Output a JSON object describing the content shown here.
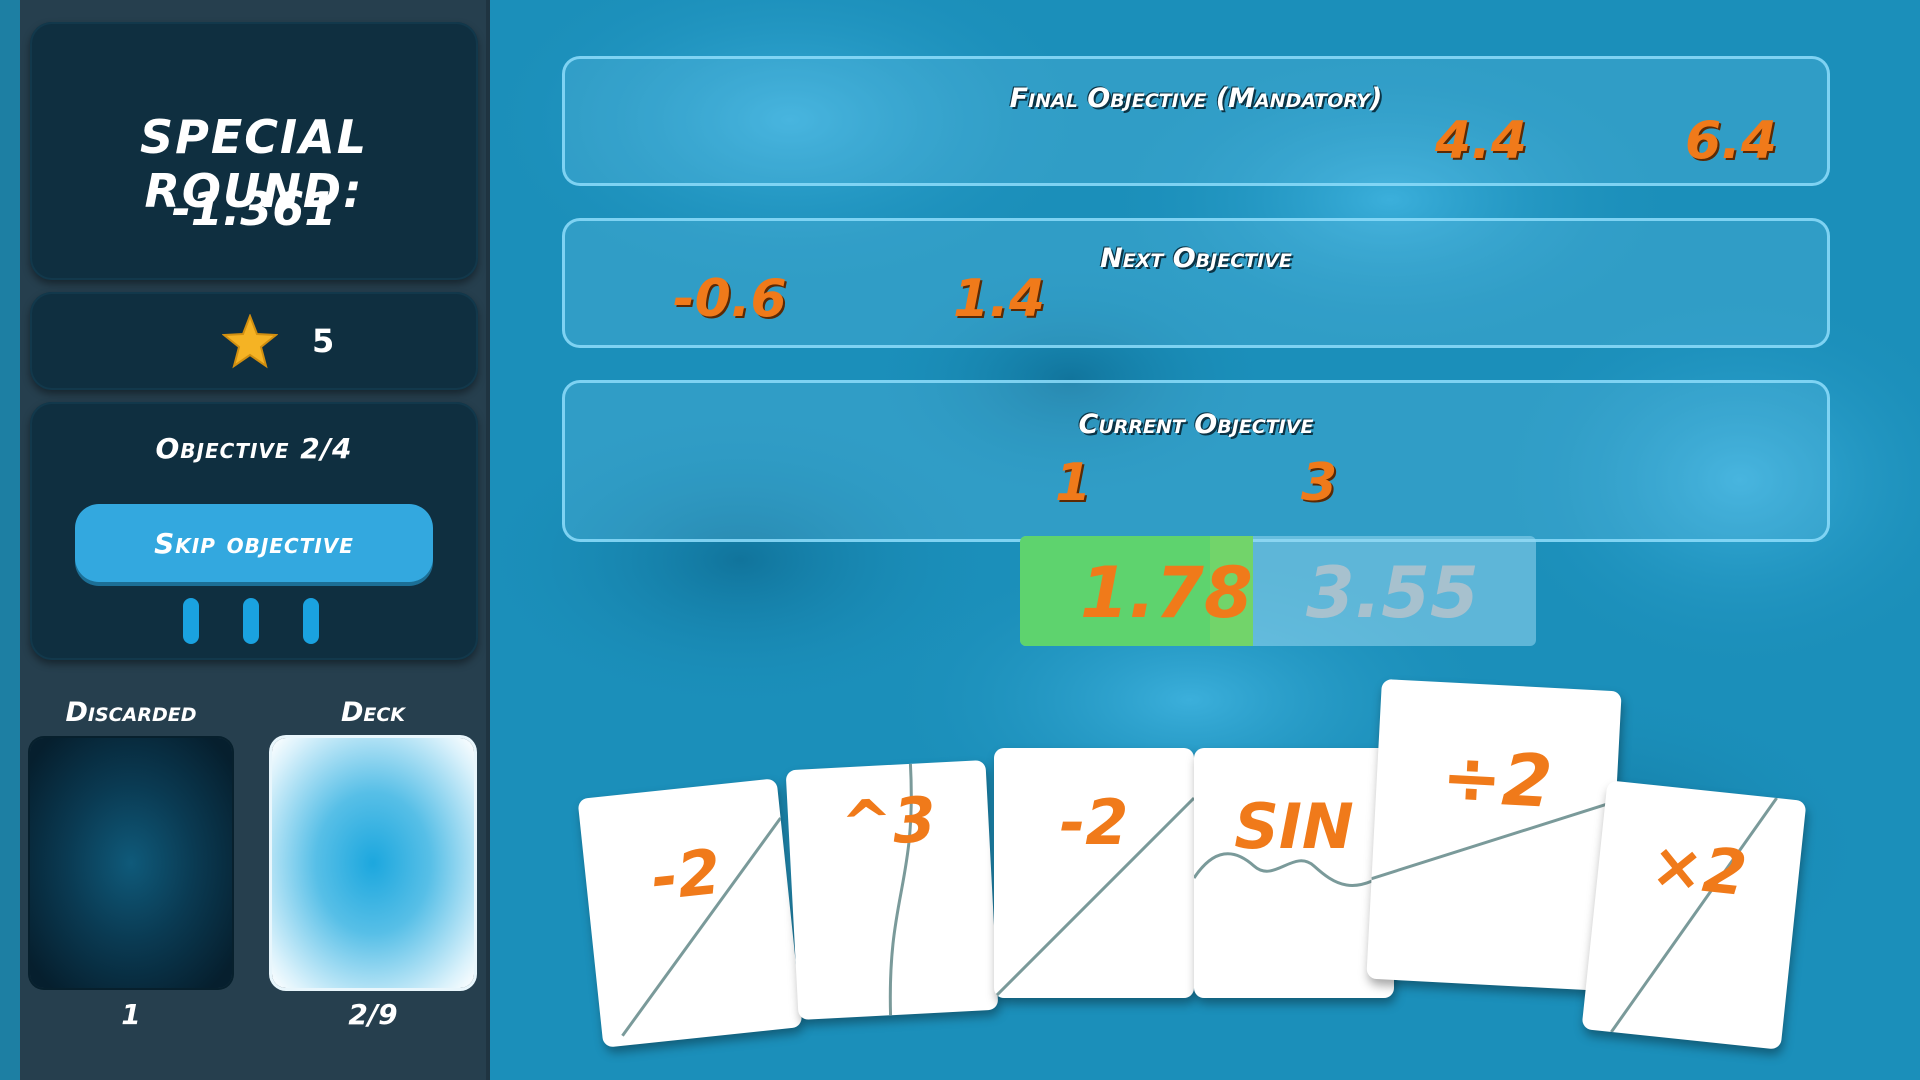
{
  "special_round": {
    "title": "SPECIAL ROUND:",
    "value": "-1.361"
  },
  "stars": {
    "icon": "star-icon",
    "count": "5",
    "color": "#f5b324"
  },
  "objective_progress": {
    "label": "Objective 2/4",
    "skip_label": "Skip objective",
    "skips_remaining": 3
  },
  "piles": {
    "discarded_label": "Discarded",
    "discarded_count": "1",
    "deck_label": "Deck",
    "deck_count": "2/9"
  },
  "objectives": {
    "final": {
      "title": "Final Objective (Mandatory)",
      "low": "4.4",
      "high": "6.4"
    },
    "next": {
      "title": "Next Objective",
      "low": "-0.6",
      "high": "1.4"
    },
    "current": {
      "title": "Current Objective",
      "low": "1",
      "high": "3"
    }
  },
  "meter": {
    "current_value": "1.78",
    "preview_value": "3.55",
    "fill_color": "#5ed36e"
  },
  "hand": [
    {
      "label": "-2",
      "graph": "linear"
    },
    {
      "label": "^3",
      "graph": "cubic"
    },
    {
      "label": "-2",
      "graph": "linear"
    },
    {
      "label": "SIN",
      "graph": "sine"
    },
    {
      "label": "÷2",
      "graph": "linear-half"
    },
    {
      "label": "×2",
      "graph": "linear-double"
    }
  ],
  "colors": {
    "accent_orange": "#f07a1a",
    "panel_dark": "#0f2f40",
    "button_blue": "#33a8df"
  }
}
